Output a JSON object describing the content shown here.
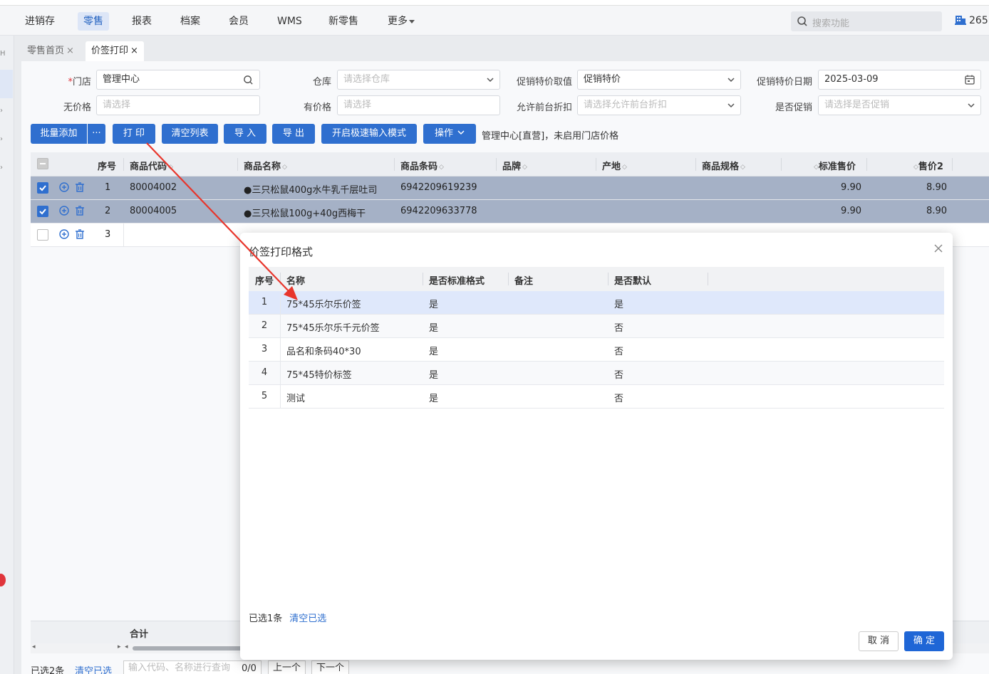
{
  "top_nav": {
    "items": [
      "进销存",
      "零售",
      "报表",
      "档案",
      "会员",
      "WMS",
      "新零售",
      "更多"
    ],
    "active": "零售",
    "search_placeholder": "搜索功能",
    "user_code": "265"
  },
  "tabs": [
    {
      "label": "零售首页"
    },
    {
      "label": "价签打印"
    }
  ],
  "form": {
    "store_label": "门店",
    "store_value": "管理中心",
    "warehouse_label": "仓库",
    "warehouse_placeholder": "请选择仓库",
    "promo_value_label": "促销特价取值",
    "promo_value": "促销特价",
    "promo_date_label": "促销特价日期",
    "promo_date": "2025-03-09",
    "no_price_label": "无价格",
    "no_price_placeholder": "请选择",
    "has_price_label": "有价格",
    "has_price_placeholder": "请选择",
    "allow_discount_label": "允许前台折扣",
    "allow_discount_placeholder": "请选择允许前台折扣",
    "is_promo_label": "是否促销",
    "is_promo_placeholder": "请选择是否促销"
  },
  "toolbar": {
    "batch_add": "批量添加",
    "more": "···",
    "print": "打 印",
    "clear_list": "清空列表",
    "import": "导 入",
    "export": "导 出",
    "fast_input": "开启极速输入模式",
    "operation": "操作",
    "info": "管理中心[直营]，未启用门店价格"
  },
  "grid": {
    "columns": [
      "序号",
      "商品代码",
      "商品名称",
      "商品条码",
      "品牌",
      "产地",
      "商品规格",
      "标准售价",
      "售价2"
    ],
    "rows": [
      {
        "index": "1",
        "code": "80004002",
        "name": "●三只松鼠400g水牛乳千层吐司",
        "barcode": "6942209619239",
        "std_price": "9.90",
        "price2": "8.90",
        "checked": true
      },
      {
        "index": "2",
        "code": "80004005",
        "name": "●三只松鼠100g+40g西梅干",
        "barcode": "6942209633778",
        "std_price": "9.90",
        "price2": "8.90",
        "checked": true
      },
      {
        "index": "3",
        "code": "",
        "name": "",
        "barcode": "",
        "std_price": "",
        "price2": "",
        "checked": false
      }
    ],
    "sum_label": "合计"
  },
  "bottom": {
    "selected": "已选2条",
    "clear": "清空已选",
    "search_placeholder": "输入代码、名称进行查询",
    "counter": "0/0",
    "prev": "上一个",
    "next": "下一个"
  },
  "modal": {
    "title": "价签打印格式",
    "columns": [
      "序号",
      "名称",
      "是否标准格式",
      "备注",
      "是否默认"
    ],
    "rows": [
      {
        "index": "1",
        "name": "75*45乐尔乐价签",
        "standard": "是",
        "remark": "",
        "default": "是"
      },
      {
        "index": "2",
        "name": "75*45乐尔乐千元价签",
        "standard": "是",
        "remark": "",
        "default": "否"
      },
      {
        "index": "3",
        "name": "品名和条码40*30",
        "standard": "是",
        "remark": "",
        "default": "否"
      },
      {
        "index": "4",
        "name": "75*45特价标签",
        "standard": "是",
        "remark": "",
        "default": "否"
      },
      {
        "index": "5",
        "name": "测试",
        "standard": "是",
        "remark": "",
        "default": "否"
      }
    ],
    "selected_info": "已选1条",
    "clear_selected": "清空已选",
    "cancel": "取 消",
    "ok": "确 定"
  },
  "colors": {
    "primary": "#2f6fcf",
    "selected_row": "#a5b1c6",
    "modal_selected_row": "#dfe8fb",
    "arrow": "#e8352b"
  }
}
